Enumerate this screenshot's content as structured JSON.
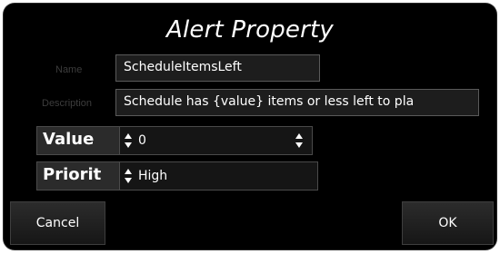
{
  "dialog": {
    "title": "Alert Property"
  },
  "name": {
    "label": "Name",
    "value": "ScheduleItemsLeft"
  },
  "description": {
    "label": "Description",
    "value": "Schedule has {value} items or less left to pla"
  },
  "value_field": {
    "label": "Value",
    "value": "0"
  },
  "priority_field": {
    "label": "Priorit",
    "value": "High"
  },
  "buttons": {
    "cancel": "Cancel",
    "ok": "OK"
  },
  "icons": {
    "spin": "updown-arrows-icon"
  }
}
